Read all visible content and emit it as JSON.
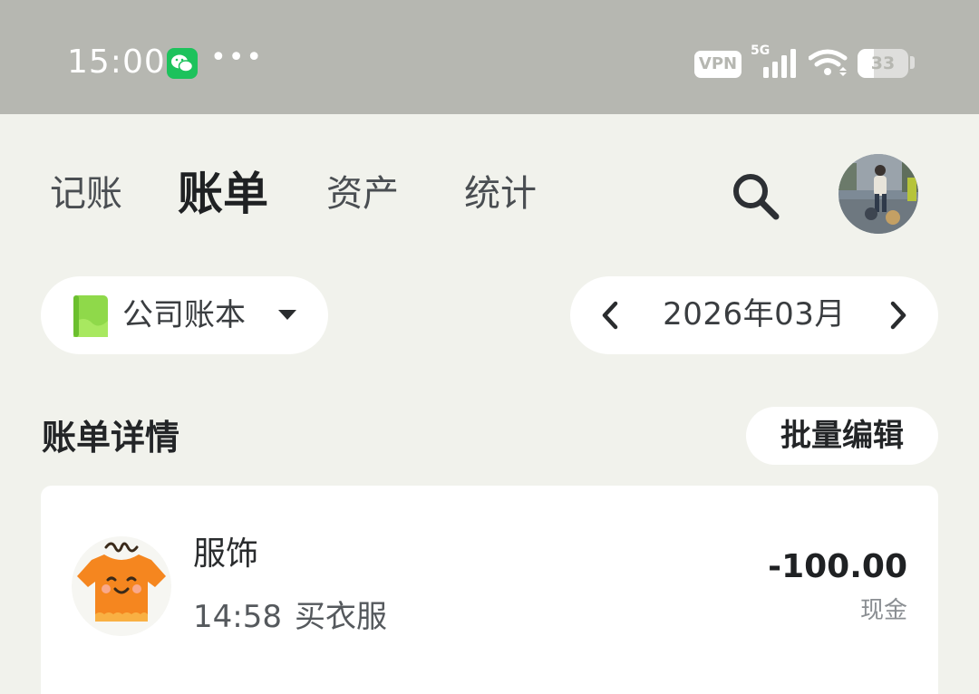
{
  "status_bar": {
    "time": "15:00",
    "app_icon": "wechat-icon",
    "more": "•••",
    "vpn_label": "VPN",
    "network": "5G",
    "battery": "33",
    "battery_level": 0.33
  },
  "tabs": [
    {
      "label": "记账",
      "active": false
    },
    {
      "label": "账单",
      "active": true
    },
    {
      "label": "资产",
      "active": false
    },
    {
      "label": "统计",
      "active": false
    }
  ],
  "header_icons": {
    "search": "search-icon",
    "avatar": "user-avatar"
  },
  "ledger": {
    "name": "公司账本",
    "icon": "ledger-book-icon"
  },
  "month": {
    "label": "2026年03月"
  },
  "section": {
    "title": "账单详情",
    "batch_edit": "批量编辑"
  },
  "bills": [
    {
      "category": "服饰",
      "time": "14:58",
      "note": "买衣服",
      "amount": "-100.00",
      "account": "现金",
      "icon": "clothing-icon"
    }
  ],
  "colors": {
    "status_bar_bg": "#b6b7b1",
    "page_bg": "#f1f2ec",
    "wechat_green": "#1dc25c",
    "ledger_green": "#8fd94a",
    "clothing_orange": "#f5861f"
  }
}
